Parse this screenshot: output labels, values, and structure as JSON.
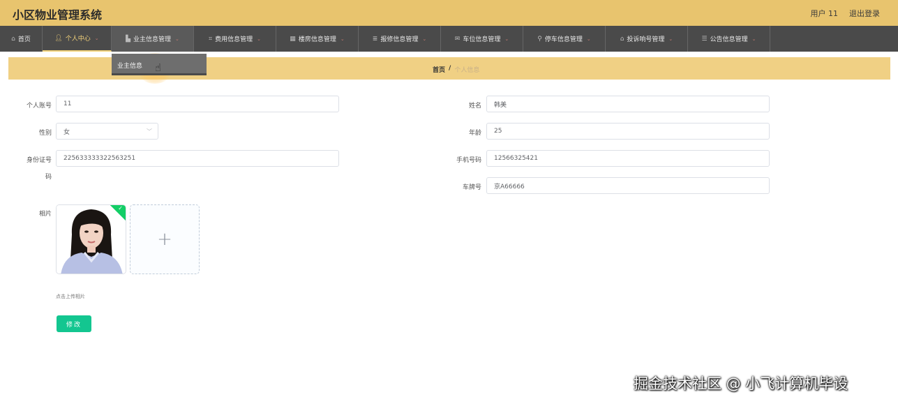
{
  "header": {
    "title": "小区物业管理系统",
    "user_label": "用户 11",
    "logout_label": "退出登录"
  },
  "nav": {
    "items": [
      {
        "label": "首页",
        "icon": "home-icon"
      },
      {
        "label": "个人中心",
        "icon": "user-icon"
      },
      {
        "label": "业主信息管理",
        "icon": "house-icon"
      },
      {
        "label": "费用信息管理",
        "icon": "crop-icon"
      },
      {
        "label": "楼房信息管理",
        "icon": "building-icon"
      },
      {
        "label": "报修信息管理",
        "icon": "list-icon"
      },
      {
        "label": "车位信息管理",
        "icon": "mail-icon"
      },
      {
        "label": "停车信息管理",
        "icon": "location-icon"
      },
      {
        "label": "投诉响号管理",
        "icon": "bank-icon"
      },
      {
        "label": "公告信息管理",
        "icon": "menu-icon"
      }
    ],
    "dropdown_item": "业主信息"
  },
  "breadcrumb": {
    "home": "首页",
    "separator": "/",
    "current": "个人信息"
  },
  "form": {
    "account_label": "个人账号",
    "account_value": "11",
    "name_label": "姓名",
    "name_value": "韩美",
    "gender_label": "性别",
    "gender_value": "女",
    "age_label": "年龄",
    "age_value": "25",
    "idcard_label_line1": "身份证号",
    "idcard_label_line2": "码",
    "idcard_value": "225633333322563251",
    "phone_label": "手机号码",
    "phone_value": "12566325421",
    "plate_label": "车牌号",
    "plate_value": "京A66666",
    "photo_label": "相片",
    "upload_plus": "+",
    "upload_hint": "点击上传相片",
    "submit_label": "修改"
  },
  "watermark": "掘金技术社区 @ 小飞计算机毕设",
  "colors": {
    "header_bg": "#e8c46e",
    "nav_bg": "#4a4a4a",
    "breadcrumb_bg": "#f0d084",
    "accent_button": "#13c690",
    "upload_success": "#13ce66"
  }
}
